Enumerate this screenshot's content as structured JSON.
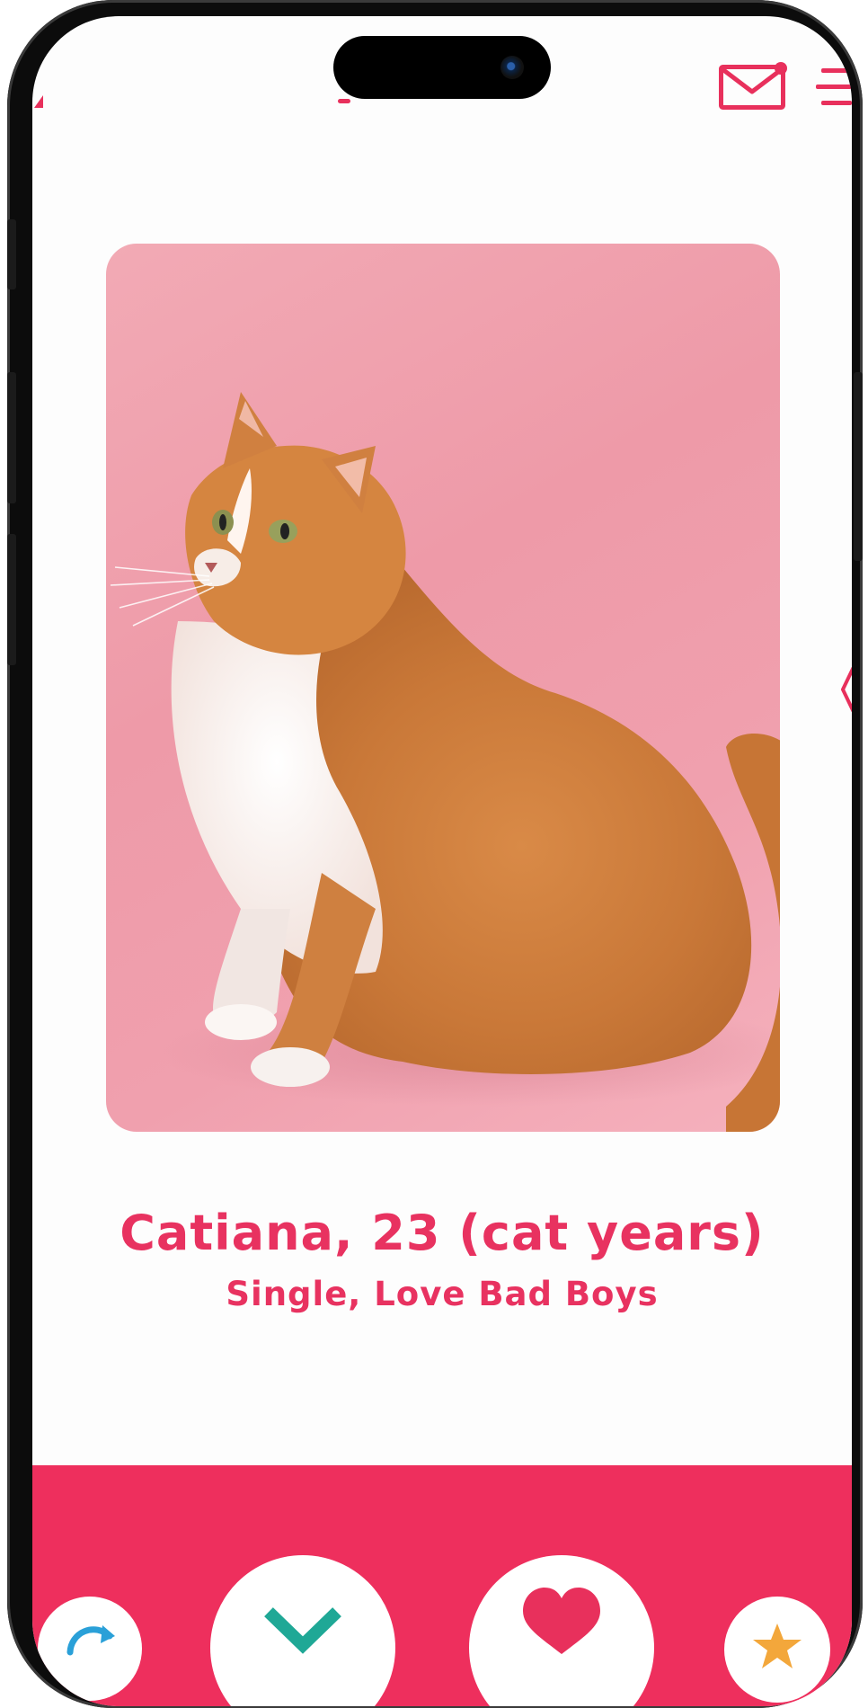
{
  "app": {
    "accent_color": "#ee2f5d",
    "text_color": "#e83260"
  },
  "header": {
    "messages_icon": "envelope-icon",
    "messages_has_unread": true,
    "menu_icon": "hamburger-menu-icon"
  },
  "profile": {
    "name_line": "Catiana, 23 (cat years)",
    "status_line": "Single, Love Bad Boys",
    "photo_icon": "ginger-cat-photo"
  },
  "actions": {
    "rewind_icon": "rewind-icon",
    "nope_icon": "nope-x-icon",
    "like_icon": "heart-icon",
    "super_like_icon": "star-icon"
  }
}
